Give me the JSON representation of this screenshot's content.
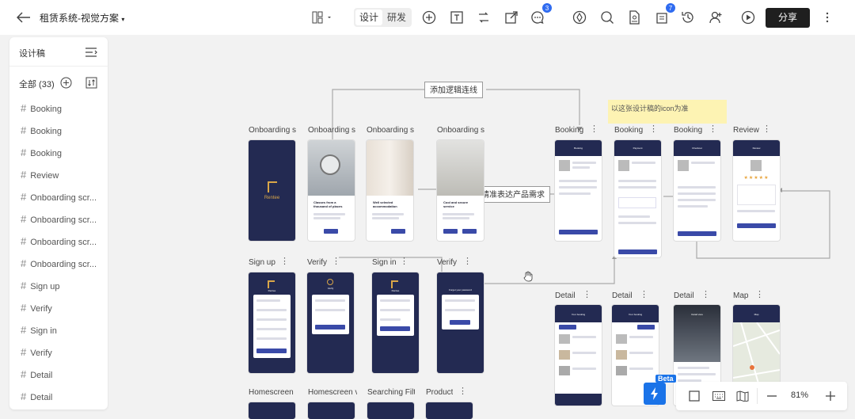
{
  "header": {
    "project_title": "租赁系统-视觉方案",
    "mode_design": "设计",
    "mode_dev": "研发",
    "comments_badge": "3",
    "assets_badge": "7",
    "share_label": "分享"
  },
  "sidebar": {
    "title": "设计稿",
    "all_label": "全部 (33)",
    "items": [
      "Booking",
      "Booking",
      "Booking",
      "Review",
      "Onboarding scr...",
      "Onboarding scr...",
      "Onboarding scr...",
      "Onboarding scr...",
      "Sign up",
      "Verify",
      "Sign in",
      "Verify",
      "Detail",
      "Detail"
    ]
  },
  "canvas": {
    "notes": [
      "添加逻辑连线",
      "精准表达产品需求"
    ],
    "sticky": "以这张设计稿的icon为准",
    "row1_labels": [
      "Onboarding s",
      "Onboarding s",
      "Onboarding s",
      "Onboarding s"
    ],
    "row1_right_labels": [
      "Booking",
      "Booking",
      "Booking",
      "Review"
    ],
    "row2_labels": [
      "Sign up",
      "Verify",
      "Sign in",
      "Verify"
    ],
    "row2_right_labels": [
      "Detail",
      "Detail",
      "Detail",
      "Map"
    ],
    "row3_labels": [
      "Homescreen",
      "Homescreen v",
      "Searching Filte",
      "Product"
    ],
    "brand": "Rentee",
    "onboard_heads": [
      "Classes from a thousand of places",
      "Well selected accommodation",
      "Cool and secure service"
    ],
    "phone_titles": [
      "Verify",
      "Forget your password",
      "Your booking",
      "Your booking",
      "Detail view",
      "Map",
      "Booking",
      "Payment",
      "Checkout",
      "Review"
    ]
  },
  "toolbar": {
    "beta": "Beta",
    "zoom": "81%"
  }
}
